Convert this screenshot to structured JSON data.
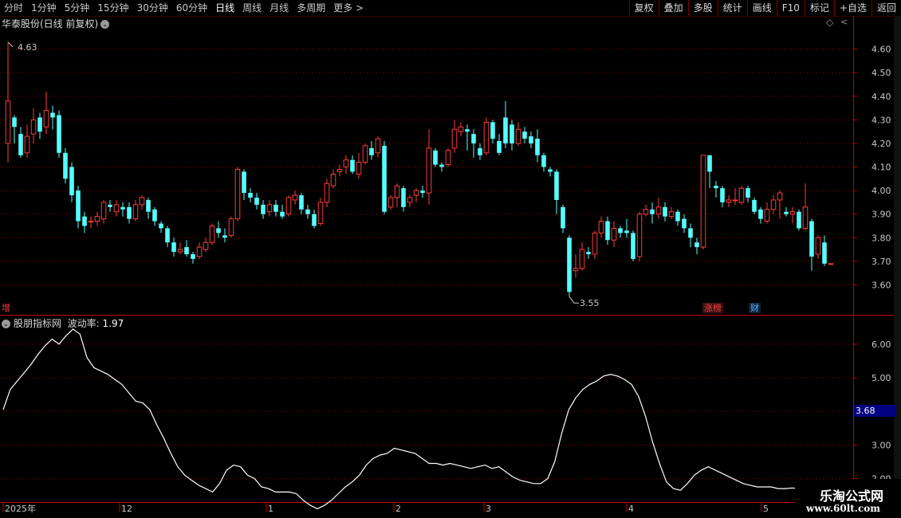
{
  "toolbar": {
    "tabs": [
      {
        "label": "分时",
        "active": false
      },
      {
        "label": "1分钟",
        "active": false
      },
      {
        "label": "5分钟",
        "active": false
      },
      {
        "label": "15分钟",
        "active": false
      },
      {
        "label": "30分钟",
        "active": false
      },
      {
        "label": "60分钟",
        "active": false
      },
      {
        "label": "日线",
        "active": true
      },
      {
        "label": "周线",
        "active": false
      },
      {
        "label": "月线",
        "active": false
      },
      {
        "label": "多周期",
        "active": false
      },
      {
        "label": "更多 >",
        "active": false
      }
    ],
    "right_buttons": [
      "复权",
      "叠加",
      "多股",
      "统计",
      "画线",
      "F10",
      "标记",
      "+自选",
      "返回"
    ]
  },
  "main_chart": {
    "title": "华泰股份(日线 前复权)",
    "high_label": "4.63",
    "low_label": "3.55",
    "left_tag": "增",
    "tags": [
      {
        "text": "涨榜",
        "color": "#ff3b3b"
      },
      {
        "text": "财",
        "color": "#5ab0ff"
      }
    ],
    "yticks": [
      "4.60",
      "4.50",
      "4.40",
      "4.30",
      "4.20",
      "4.10",
      "4.00",
      "3.90",
      "3.80",
      "3.70",
      "3.60"
    ]
  },
  "indicator": {
    "name": "股朋指标网",
    "series_label": "波动率:",
    "series_value": "1.97",
    "yticks": [
      "6.00",
      "5.00",
      "4.00",
      "3.00",
      "2.00"
    ],
    "current_value": "3.68"
  },
  "time_axis": [
    "2025年",
    "12",
    "1",
    "2",
    "3",
    "4",
    "5"
  ],
  "watermark": {
    "line1": "乐淘公式网",
    "line2": "www.60lt.com"
  },
  "colors": {
    "up": "#ff3b3b",
    "down": "#54ffff",
    "grid": "#8b0000",
    "line": "#ffffff",
    "axis": "#c80000"
  },
  "chart_data": [
    {
      "type": "candlestick",
      "title": "华泰股份(日线 前复权)",
      "ylim": [
        3.5,
        4.68
      ],
      "candles": [
        [
          4.2,
          4.38,
          4.63,
          4.12
        ],
        [
          4.31,
          4.27,
          4.32,
          4.2
        ],
        [
          4.24,
          4.15,
          4.27,
          4.14
        ],
        [
          4.16,
          4.23,
          4.28,
          4.14
        ],
        [
          4.24,
          4.3,
          4.35,
          4.2
        ],
        [
          4.31,
          4.25,
          4.33,
          4.22
        ],
        [
          4.27,
          4.34,
          4.42,
          4.24
        ],
        [
          4.33,
          4.31,
          4.36,
          4.26
        ],
        [
          4.32,
          4.16,
          4.34,
          4.14
        ],
        [
          4.16,
          4.05,
          4.18,
          4.03
        ],
        [
          4.1,
          3.98,
          4.12,
          3.95
        ],
        [
          4.0,
          3.87,
          4.02,
          3.84
        ],
        [
          3.89,
          3.85,
          3.91,
          3.82
        ],
        [
          3.87,
          3.87,
          3.89,
          3.84
        ],
        [
          3.87,
          3.89,
          3.91,
          3.85
        ],
        [
          3.88,
          3.95,
          3.96,
          3.86
        ],
        [
          3.94,
          3.93,
          3.96,
          3.91
        ],
        [
          3.91,
          3.94,
          3.96,
          3.89
        ],
        [
          3.93,
          3.92,
          3.95,
          3.89
        ],
        [
          3.93,
          3.88,
          3.95,
          3.86
        ],
        [
          3.88,
          3.94,
          3.96,
          3.87
        ],
        [
          3.94,
          3.97,
          3.98,
          3.92
        ],
        [
          3.96,
          3.91,
          3.97,
          3.88
        ],
        [
          3.92,
          3.87,
          3.93,
          3.85
        ],
        [
          3.86,
          3.84,
          3.87,
          3.82
        ],
        [
          3.84,
          3.78,
          3.85,
          3.76
        ],
        [
          3.78,
          3.74,
          3.8,
          3.72
        ],
        [
          3.74,
          3.75,
          3.78,
          3.73
        ],
        [
          3.76,
          3.73,
          3.79,
          3.72
        ],
        [
          3.73,
          3.71,
          3.74,
          3.69
        ],
        [
          3.72,
          3.76,
          3.78,
          3.71
        ],
        [
          3.75,
          3.78,
          3.8,
          3.74
        ],
        [
          3.78,
          3.85,
          3.86,
          3.77
        ],
        [
          3.84,
          3.82,
          3.87,
          3.8
        ],
        [
          3.81,
          3.8,
          3.84,
          3.78
        ],
        [
          3.81,
          3.88,
          3.89,
          3.8
        ],
        [
          3.88,
          4.09,
          4.1,
          3.87
        ],
        [
          4.08,
          3.99,
          4.09,
          3.96
        ],
        [
          3.99,
          3.97,
          4.01,
          3.95
        ],
        [
          3.97,
          3.94,
          3.99,
          3.92
        ],
        [
          3.94,
          3.9,
          3.96,
          3.88
        ],
        [
          3.91,
          3.94,
          3.96,
          3.89
        ],
        [
          3.94,
          3.91,
          3.96,
          3.89
        ],
        [
          3.91,
          3.89,
          3.94,
          3.88
        ],
        [
          3.9,
          3.97,
          3.98,
          3.89
        ],
        [
          3.96,
          3.98,
          4.0,
          3.94
        ],
        [
          3.98,
          3.92,
          3.99,
          3.9
        ],
        [
          3.92,
          3.9,
          3.94,
          3.88
        ],
        [
          3.9,
          3.85,
          3.92,
          3.84
        ],
        [
          3.86,
          3.95,
          3.97,
          3.85
        ],
        [
          3.95,
          4.03,
          4.05,
          3.93
        ],
        [
          4.02,
          4.07,
          4.09,
          4.01
        ],
        [
          4.08,
          4.09,
          4.11,
          4.06
        ],
        [
          4.1,
          4.13,
          4.15,
          4.07
        ],
        [
          4.13,
          4.08,
          4.15,
          4.07
        ],
        [
          4.07,
          4.12,
          4.16,
          4.05
        ],
        [
          4.12,
          4.19,
          4.2,
          4.11
        ],
        [
          4.18,
          4.15,
          4.21,
          4.13
        ],
        [
          4.16,
          4.22,
          4.23,
          4.14
        ],
        [
          4.19,
          3.91,
          4.21,
          3.9
        ],
        [
          3.93,
          3.97,
          3.98,
          3.92
        ],
        [
          3.97,
          4.02,
          4.03,
          3.93
        ],
        [
          4.01,
          3.93,
          4.02,
          3.91
        ],
        [
          3.95,
          3.97,
          3.98,
          3.93
        ],
        [
          3.98,
          4.0,
          4.01,
          3.95
        ],
        [
          4.0,
          3.99,
          4.02,
          3.97
        ],
        [
          3.99,
          4.18,
          4.26,
          3.94
        ],
        [
          4.17,
          4.11,
          4.18,
          4.1
        ],
        [
          4.11,
          4.1,
          4.12,
          4.08
        ],
        [
          4.11,
          4.17,
          4.18,
          4.1
        ],
        [
          4.18,
          4.26,
          4.3,
          4.16
        ],
        [
          4.25,
          4.27,
          4.29,
          4.23
        ],
        [
          4.26,
          4.25,
          4.28,
          4.17
        ],
        [
          4.24,
          4.2,
          4.26,
          4.14
        ],
        [
          4.18,
          4.15,
          4.2,
          4.13
        ],
        [
          4.16,
          4.29,
          4.31,
          4.15
        ],
        [
          4.29,
          4.22,
          4.3,
          4.2
        ],
        [
          4.21,
          4.16,
          4.24,
          4.15
        ],
        [
          4.31,
          4.2,
          4.38,
          4.18
        ],
        [
          4.28,
          4.2,
          4.3,
          4.17
        ],
        [
          4.2,
          4.26,
          4.29,
          4.19
        ],
        [
          4.25,
          4.22,
          4.27,
          4.2
        ],
        [
          4.23,
          4.2,
          4.25,
          4.18
        ],
        [
          4.22,
          4.15,
          4.26,
          4.12
        ],
        [
          4.15,
          4.1,
          4.16,
          4.08
        ],
        [
          4.09,
          4.08,
          4.1,
          4.06
        ],
        [
          4.08,
          3.96,
          4.09,
          3.9
        ],
        [
          3.93,
          3.84,
          3.94,
          3.82
        ],
        [
          3.8,
          3.57,
          3.81,
          3.55
        ],
        [
          3.66,
          3.67,
          3.73,
          3.63
        ],
        [
          3.67,
          3.75,
          3.78,
          3.66
        ],
        [
          3.74,
          3.73,
          3.76,
          3.71
        ],
        [
          3.73,
          3.82,
          3.83,
          3.71
        ],
        [
          3.82,
          3.87,
          3.89,
          3.8
        ],
        [
          3.87,
          3.79,
          3.89,
          3.77
        ],
        [
          3.79,
          3.84,
          3.87,
          3.76
        ],
        [
          3.84,
          3.82,
          3.85,
          3.8
        ],
        [
          3.83,
          3.82,
          3.88,
          3.8
        ],
        [
          3.82,
          3.71,
          3.83,
          3.7
        ],
        [
          3.72,
          3.9,
          3.91,
          3.7
        ],
        [
          3.9,
          3.92,
          3.94,
          3.89
        ],
        [
          3.92,
          3.9,
          3.95,
          3.86
        ],
        [
          3.9,
          3.93,
          3.97,
          3.88
        ],
        [
          3.93,
          3.89,
          3.95,
          3.87
        ],
        [
          3.89,
          3.91,
          3.93,
          3.88
        ],
        [
          3.91,
          3.87,
          3.92,
          3.85
        ],
        [
          3.88,
          3.84,
          3.9,
          3.82
        ],
        [
          3.84,
          3.8,
          3.86,
          3.76
        ],
        [
          3.78,
          3.76,
          3.8,
          3.73
        ],
        [
          3.76,
          4.15,
          4.15,
          3.75
        ],
        [
          4.15,
          4.08,
          4.15,
          4.01
        ],
        [
          4.02,
          4.01,
          4.04,
          3.97
        ],
        [
          4.01,
          3.95,
          4.02,
          3.93
        ],
        [
          3.95,
          3.96,
          3.98,
          3.93
        ],
        [
          3.96,
          3.96,
          4.01,
          3.94
        ],
        [
          3.95,
          4.01,
          4.02,
          3.94
        ],
        [
          4.01,
          3.97,
          4.02,
          3.95
        ],
        [
          3.96,
          3.91,
          3.97,
          3.9
        ],
        [
          3.92,
          3.88,
          3.93,
          3.86
        ],
        [
          3.87,
          3.92,
          3.95,
          3.86
        ],
        [
          3.92,
          3.96,
          3.98,
          3.9
        ],
        [
          3.96,
          3.99,
          4.0,
          3.88
        ],
        [
          3.91,
          3.9,
          3.93,
          3.89
        ],
        [
          3.9,
          3.91,
          3.93,
          3.86
        ],
        [
          3.91,
          3.84,
          3.92,
          3.83
        ],
        [
          3.84,
          3.93,
          4.03,
          3.83
        ],
        [
          3.87,
          3.72,
          3.88,
          3.66
        ],
        [
          3.73,
          3.8,
          3.81,
          3.71
        ],
        [
          3.78,
          3.69,
          3.81,
          3.68
        ],
        [
          3.69,
          3.69,
          3.69,
          3.69
        ]
      ]
    },
    {
      "type": "line",
      "title": "波动率",
      "ylim": [
        1.3,
        6.85
      ],
      "series": [
        {
          "name": "波动率",
          "values": [
            4.05,
            4.65,
            4.9,
            5.15,
            5.4,
            5.7,
            5.95,
            6.15,
            6.0,
            6.25,
            6.45,
            6.3,
            5.6,
            5.3,
            5.2,
            5.1,
            4.95,
            4.8,
            4.55,
            4.3,
            4.25,
            4.05,
            3.6,
            3.2,
            2.75,
            2.35,
            2.1,
            1.95,
            1.8,
            1.7,
            1.6,
            1.85,
            2.25,
            2.4,
            2.35,
            2.1,
            2.0,
            1.75,
            1.7,
            1.6,
            1.6,
            1.6,
            1.55,
            1.35,
            1.2,
            1.1,
            1.2,
            1.35,
            1.55,
            1.75,
            1.9,
            2.1,
            2.4,
            2.6,
            2.7,
            2.75,
            2.9,
            2.85,
            2.8,
            2.75,
            2.6,
            2.45,
            2.45,
            2.4,
            2.45,
            2.4,
            2.35,
            2.3,
            2.35,
            2.4,
            2.3,
            2.35,
            2.2,
            2.05,
            1.95,
            1.9,
            1.85,
            1.85,
            2.0,
            2.5,
            3.35,
            4.05,
            4.4,
            4.65,
            4.8,
            4.9,
            5.05,
            5.1,
            5.05,
            4.95,
            4.8,
            4.45,
            3.85,
            3.1,
            2.45,
            1.9,
            1.7,
            1.65,
            1.85,
            2.1,
            2.25,
            2.35,
            2.25,
            2.15,
            2.05,
            1.95,
            1.85,
            1.8,
            1.75,
            1.75,
            1.75,
            1.7,
            1.7,
            1.72,
            1.7,
            1.68,
            1.65,
            1.7,
            1.8,
            1.97
          ]
        }
      ]
    }
  ]
}
